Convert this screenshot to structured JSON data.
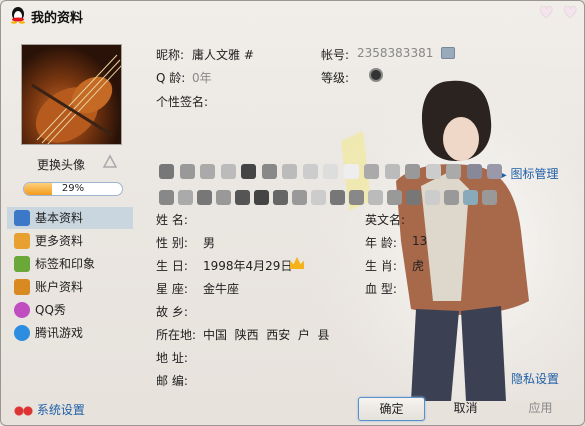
{
  "window": {
    "title": "我的资料"
  },
  "profile": {
    "change_avatar": "更换头像",
    "completion": 29,
    "completion_text": "29%"
  },
  "nav": [
    {
      "label": "基本资料"
    },
    {
      "label": "更多资料"
    },
    {
      "label": "标签和印象"
    },
    {
      "label": "账户资料"
    },
    {
      "label": "QQ秀"
    },
    {
      "label": "腾讯游戏"
    }
  ],
  "system_settings": "系统设置",
  "header": {
    "nickname_label": "昵称:",
    "nickname": "庸人文雅 #",
    "account_label": "帐号:",
    "account": "2358383381",
    "qage_label": "Q 龄:",
    "qage": "0年",
    "level_label": "等级:",
    "signature_label": "个性签名:"
  },
  "icon_manage": "图标管理",
  "fields": {
    "name_label": "姓    名:",
    "gender_label": "性    别:",
    "gender": "男",
    "birthday_label": "生    日:",
    "birthday": "1998年4月29日",
    "constellation_label": "星    座:",
    "constellation": "金牛座",
    "hometown_label": "故    乡:",
    "location_label": "所在地:",
    "location": "中国  陕西  西安  户  县",
    "address_label": "地    址:",
    "zip_label": "邮    编:",
    "english_name_label": "英文名:",
    "age_label": "年    龄:",
    "age": "13",
    "zodiac_label": "生    肖:",
    "zodiac": "虎",
    "blood_label": "血    型:"
  },
  "privacy": "隐私设置",
  "buttons": {
    "ok": "确定",
    "cancel": "取消",
    "apply": "应用"
  },
  "colors": {
    "accent": "#1f5fa8",
    "progress": "#f39b1c",
    "selected_nav": "#c9d5df"
  }
}
